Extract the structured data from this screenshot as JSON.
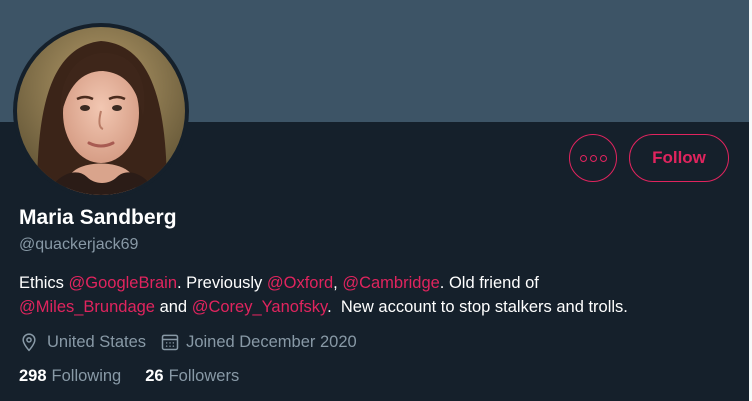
{
  "profile": {
    "name": "Maria Sandberg",
    "handle": "@quackerjack69"
  },
  "actions": {
    "more_icon": "more-horizontal-icon",
    "follow_label": "Follow"
  },
  "bio": {
    "line1": [
      {
        "text": "Ethics ",
        "mention": false
      },
      {
        "text": "@GoogleBrain",
        "mention": true
      },
      {
        "text": ". Previously ",
        "mention": false
      },
      {
        "text": "@Oxford",
        "mention": true
      },
      {
        "text": ", ",
        "mention": false
      },
      {
        "text": "@Cambridge",
        "mention": true
      },
      {
        "text": ". Old friend of",
        "mention": false
      }
    ],
    "line2": [
      {
        "text": "@Miles_Brundage",
        "mention": true
      },
      {
        "text": " and ",
        "mention": false
      },
      {
        "text": "@Corey_Yanofsky",
        "mention": true
      },
      {
        "text": ".  New account to stop stalkers and trolls.",
        "mention": false
      }
    ]
  },
  "meta": {
    "location": "United States",
    "location_icon": "location-pin-icon",
    "joined": "Joined December 2020",
    "joined_icon": "calendar-icon"
  },
  "stats": {
    "following_count": "298",
    "following_label": "Following",
    "followers_count": "26",
    "followers_label": "Followers"
  },
  "colors": {
    "background": "#15202b",
    "banner": "#3d5466",
    "accent": "#e0245e",
    "secondary_text": "#8899a6",
    "primary_text": "#ffffff"
  }
}
